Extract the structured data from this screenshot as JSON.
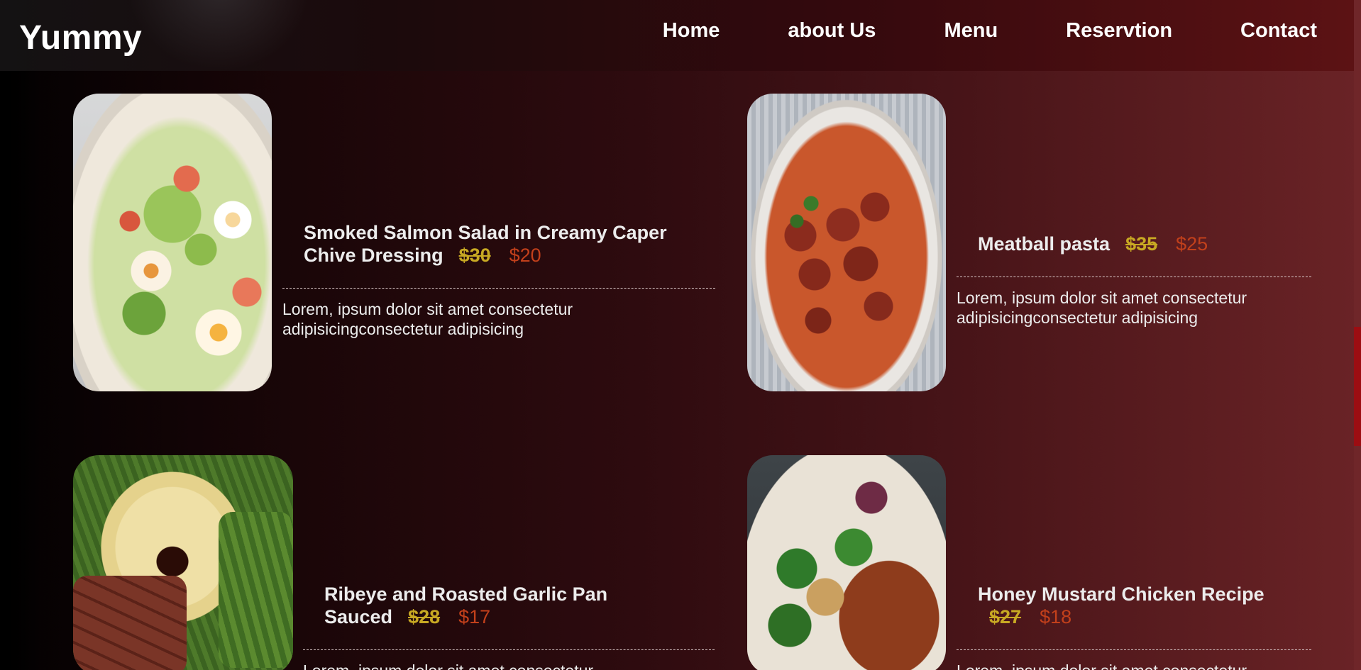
{
  "header": {
    "logo": "Yummy",
    "nav": [
      {
        "label": "Home"
      },
      {
        "label": "about Us"
      },
      {
        "label": "Menu"
      },
      {
        "label": "Reservtion"
      },
      {
        "label": "Contact"
      }
    ]
  },
  "menu": [
    {
      "title_line1": "Smoked Salmon Salad in Creamy Caper",
      "title_line2": "Chive Dressing",
      "old_price": "$30",
      "new_price": "$20",
      "description": "Lorem, ipsum dolor sit amet consectetur adipisicingconsectetur adipisicing"
    },
    {
      "title_line1": "Meatball pasta",
      "old_price": "$35",
      "new_price": "$25",
      "description": "Lorem, ipsum dolor sit amet consectetur adipisicingconsectetur adipisicing"
    },
    {
      "title_line1": "Ribeye and Roasted Garlic Pan",
      "title_line2": "Sauced",
      "old_price": "$28",
      "new_price": "$17",
      "description": "Lorem, ipsum dolor sit amet consectetur"
    },
    {
      "title_line1": "Honey Mustard Chicken Recipe",
      "old_price": "$27",
      "new_price": "$18",
      "description": "Lorem, ipsum dolor sit amet consectetur"
    }
  ],
  "colors": {
    "old_price": "#c8a923",
    "new_price": "#c2401b",
    "scrollbar_thumb": "#9c0d12"
  }
}
